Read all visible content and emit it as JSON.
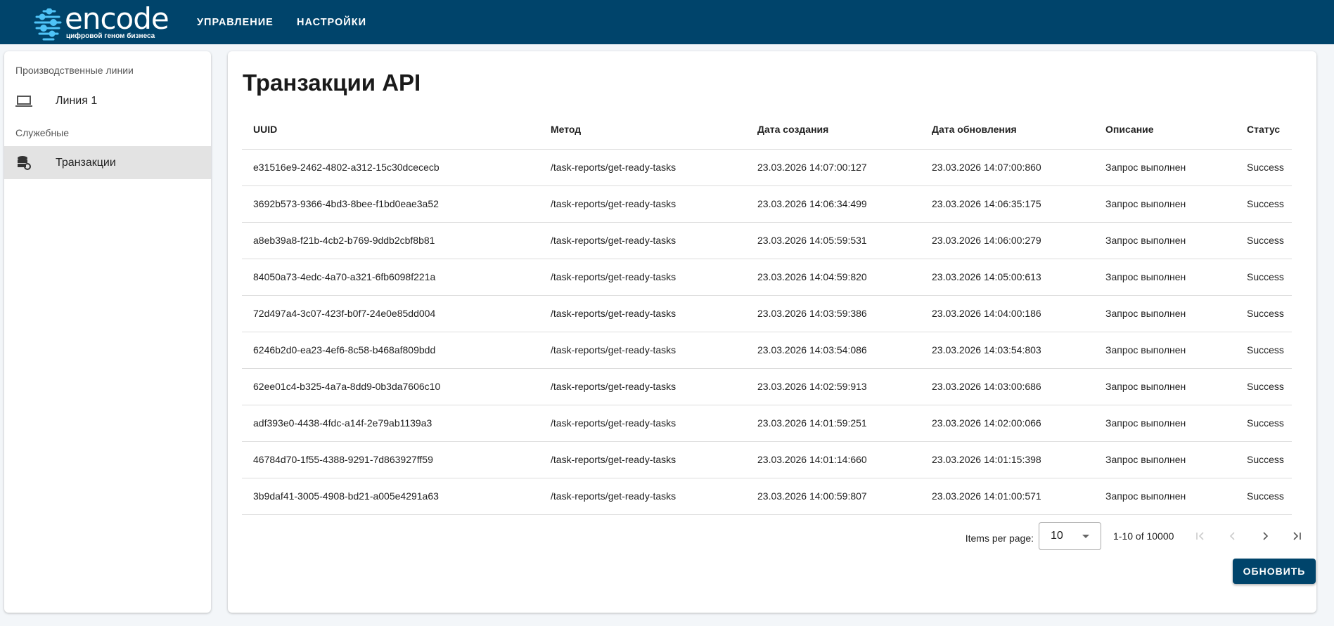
{
  "header": {
    "logo_text": "encode",
    "logo_tagline": "цифровой геном бизнеса",
    "nav": [
      "УПРАВЛЕНИЕ",
      "НАСТРОЙКИ"
    ]
  },
  "sidebar": {
    "section1": "Производственные линии",
    "line1": "Линия 1",
    "section2": "Служебные",
    "transactions": "Транзакции"
  },
  "main": {
    "title": "Транзакции API",
    "columns": [
      "UUID",
      "Метод",
      "Дата создания",
      "Дата обновления",
      "Описание",
      "Статус"
    ],
    "rows": [
      [
        "e31516e9-2462-4802-a312-15c30dcececb",
        "/task-reports/get-ready-tasks",
        "23.03.2026 14:07:00:127",
        "23.03.2026 14:07:00:860",
        "Запрос выполнен",
        "Success"
      ],
      [
        "3692b573-9366-4bd3-8bee-f1bd0eae3a52",
        "/task-reports/get-ready-tasks",
        "23.03.2026 14:06:34:499",
        "23.03.2026 14:06:35:175",
        "Запрос выполнен",
        "Success"
      ],
      [
        "a8eb39a8-f21b-4cb2-b769-9ddb2cbf8b81",
        "/task-reports/get-ready-tasks",
        "23.03.2026 14:05:59:531",
        "23.03.2026 14:06:00:279",
        "Запрос выполнен",
        "Success"
      ],
      [
        "84050a73-4edc-4a70-a321-6fb6098f221a",
        "/task-reports/get-ready-tasks",
        "23.03.2026 14:04:59:820",
        "23.03.2026 14:05:00:613",
        "Запрос выполнен",
        "Success"
      ],
      [
        "72d497a4-3c07-423f-b0f7-24e0e85dd004",
        "/task-reports/get-ready-tasks",
        "23.03.2026 14:03:59:386",
        "23.03.2026 14:04:00:186",
        "Запрос выполнен",
        "Success"
      ],
      [
        "6246b2d0-ea23-4ef6-8c58-b468af809bdd",
        "/task-reports/get-ready-tasks",
        "23.03.2026 14:03:54:086",
        "23.03.2026 14:03:54:803",
        "Запрос выполнен",
        "Success"
      ],
      [
        "62ee01c4-b325-4a7a-8dd9-0b3da7606c10",
        "/task-reports/get-ready-tasks",
        "23.03.2026 14:02:59:913",
        "23.03.2026 14:03:00:686",
        "Запрос выполнен",
        "Success"
      ],
      [
        "adf393e0-4438-4fdc-a14f-2e79ab1139a3",
        "/task-reports/get-ready-tasks",
        "23.03.2026 14:01:59:251",
        "23.03.2026 14:02:00:066",
        "Запрос выполнен",
        "Success"
      ],
      [
        "46784d70-1f55-4388-9291-7d863927ff59",
        "/task-reports/get-ready-tasks",
        "23.03.2026 14:01:14:660",
        "23.03.2026 14:01:15:398",
        "Запрос выполнен",
        "Success"
      ],
      [
        "3b9daf41-3005-4908-bd21-a005e4291a63",
        "/task-reports/get-ready-tasks",
        "23.03.2026 14:00:59:807",
        "23.03.2026 14:01:00:571",
        "Запрос выполнен",
        "Success"
      ]
    ],
    "paginator": {
      "label": "Items per page:",
      "page_size": "10",
      "range": "1-10 of 10000"
    },
    "refresh_label": "ОБНОВИТЬ"
  },
  "colors": {
    "brand": "#00446b",
    "accent": "#4fc3f7"
  }
}
